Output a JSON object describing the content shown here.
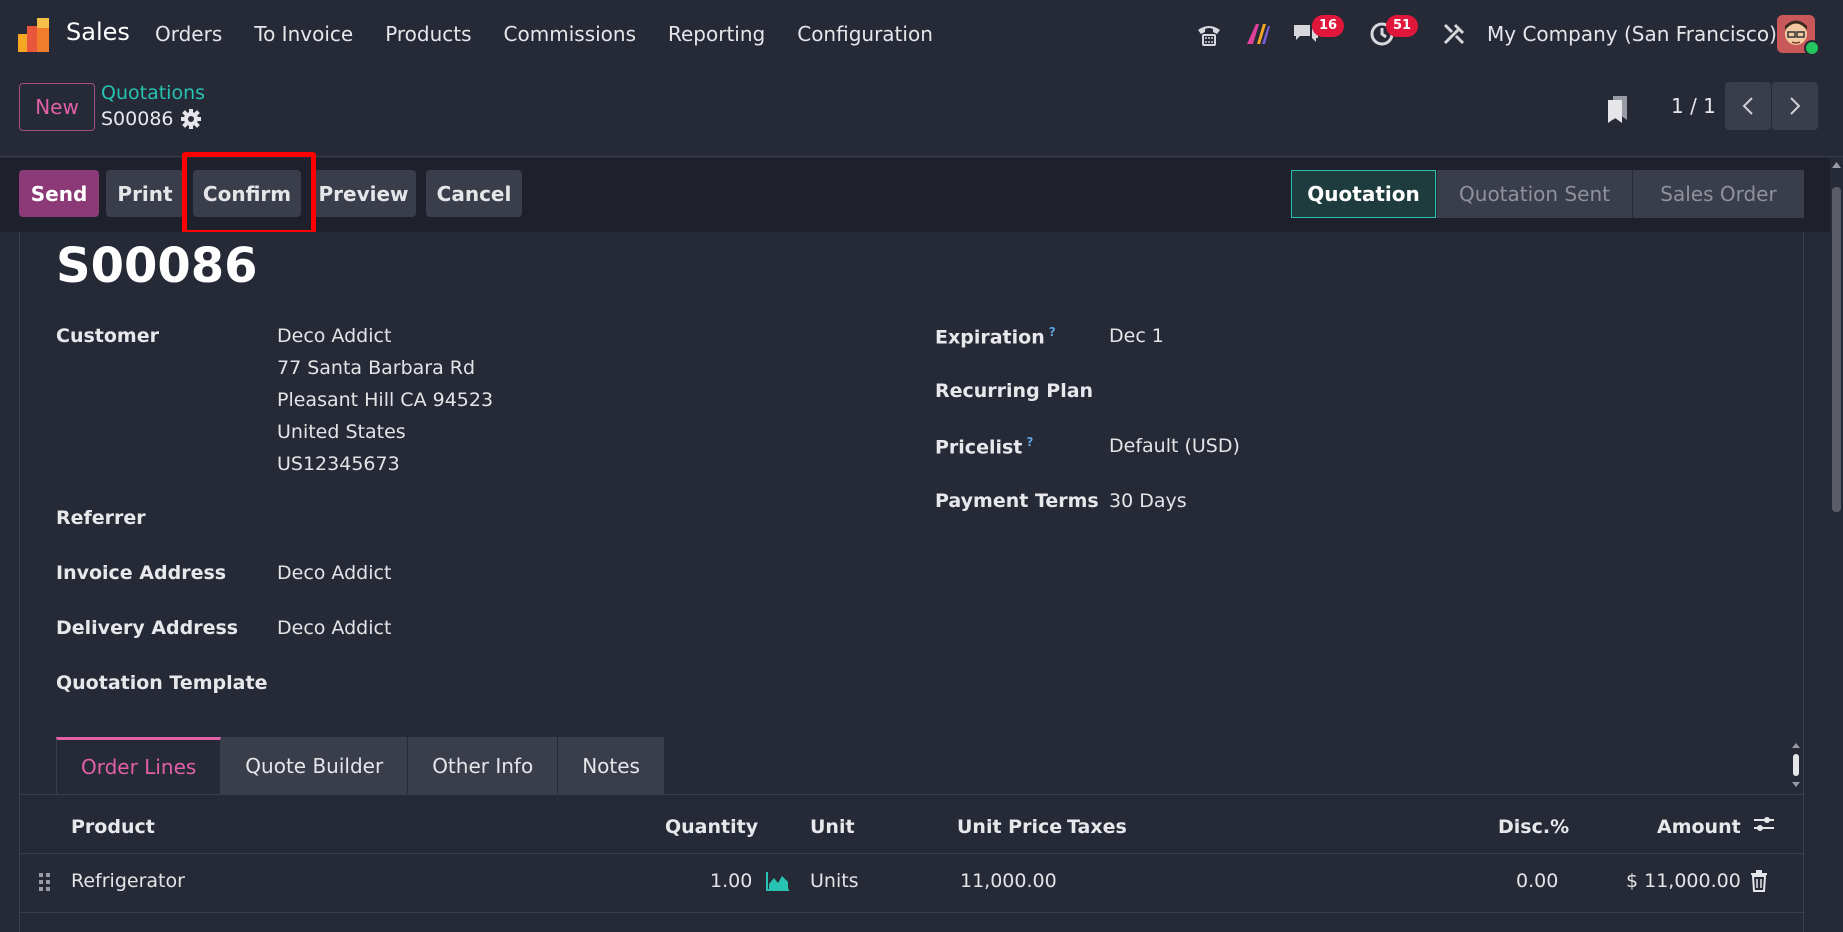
{
  "navbar": {
    "app_name": "Sales",
    "menu": [
      "Orders",
      "To Invoice",
      "Products",
      "Commissions",
      "Reporting",
      "Configuration"
    ],
    "messages_badge": "16",
    "activities_badge": "51",
    "company": "My Company (San Francisco)"
  },
  "control": {
    "new_label": "New",
    "breadcrumb": "Quotations",
    "record": "S00086",
    "pager": "1 / 1"
  },
  "actions": {
    "send": "Send",
    "print": "Print",
    "confirm": "Confirm",
    "preview": "Preview",
    "cancel": "Cancel"
  },
  "stages": [
    "Quotation",
    "Quotation Sent",
    "Sales Order"
  ],
  "form": {
    "title": "S00086",
    "customer_label": "Customer",
    "customer_lines": [
      "Deco Addict",
      "77 Santa Barbara Rd",
      "Pleasant Hill CA 94523",
      "United States",
      "US12345673"
    ],
    "referrer_label": "Referrer",
    "invoice_address_label": "Invoice Address",
    "invoice_address": "Deco Addict",
    "delivery_address_label": "Delivery Address",
    "delivery_address": "Deco Addict",
    "quotation_template_label": "Quotation Template",
    "expiration_label": "Expiration",
    "expiration": "Dec 1",
    "recurring_plan_label": "Recurring Plan",
    "pricelist_label": "Pricelist",
    "pricelist": "Default (USD)",
    "payment_terms_label": "Payment Terms",
    "payment_terms": "30 Days",
    "help_mark": "?"
  },
  "tabs": [
    "Order Lines",
    "Quote Builder",
    "Other Info",
    "Notes"
  ],
  "table": {
    "headers": {
      "product": "Product",
      "quantity": "Quantity",
      "unit": "Unit",
      "unit_price": "Unit Price",
      "taxes": "Taxes",
      "discount": "Disc.%",
      "amount": "Amount"
    },
    "rows": [
      {
        "product": "Refrigerator",
        "quantity": "1.00",
        "unit": "Units",
        "unit_price": "11,000.00",
        "taxes": "",
        "discount": "0.00",
        "amount": "$ 11,000.00"
      }
    ]
  },
  "colors": {
    "accent_pink": "#e160a8",
    "accent_teal": "#27c2b1",
    "primary_button": "#8b3a77",
    "highlight": "#ff0000"
  }
}
